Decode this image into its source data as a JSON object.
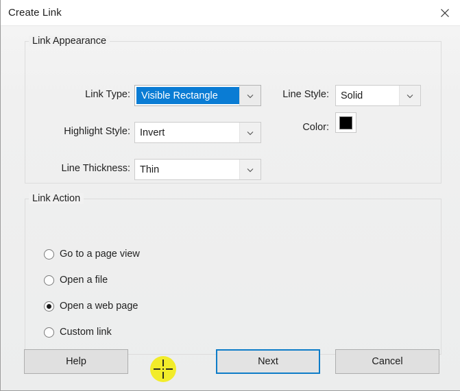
{
  "window": {
    "title": "Create Link",
    "close_icon": "close-icon"
  },
  "appearance_group": {
    "legend": "Link Appearance",
    "fields": [
      {
        "label": "Link Type:",
        "value": "Visible Rectangle",
        "focused": true,
        "icon": "chevron-down-icon"
      },
      {
        "label": "Highlight Style:",
        "value": "Invert",
        "focused": false,
        "icon": "chevron-down-icon"
      },
      {
        "label": "Line Thickness:",
        "value": "Thin",
        "focused": false,
        "icon": "chevron-down-icon"
      },
      {
        "label": "Line Style:",
        "value": "Solid",
        "focused": false,
        "icon": "chevron-down-icon"
      }
    ],
    "color": {
      "label": "Color:",
      "value": "#000000",
      "icon": "color-swatch-icon"
    }
  },
  "action_group": {
    "legend": "Link Action",
    "options": [
      {
        "label": "Go to a page view",
        "selected": false
      },
      {
        "label": "Open a file",
        "selected": false
      },
      {
        "label": "Open a web page",
        "selected": true
      },
      {
        "label": "Custom link",
        "selected": false
      }
    ]
  },
  "buttons": {
    "help": "Help",
    "next": "Next",
    "cancel": "Cancel"
  },
  "cursor": {
    "icon": "precision-crosshair-cursor",
    "highlight_color": "#f2ec2a"
  },
  "colors": {
    "accent": "#0d7cc8",
    "selection": "#0a7cd4",
    "dialog_bg": "#f0f0f0",
    "titlebar_bg": "#ffffff"
  }
}
